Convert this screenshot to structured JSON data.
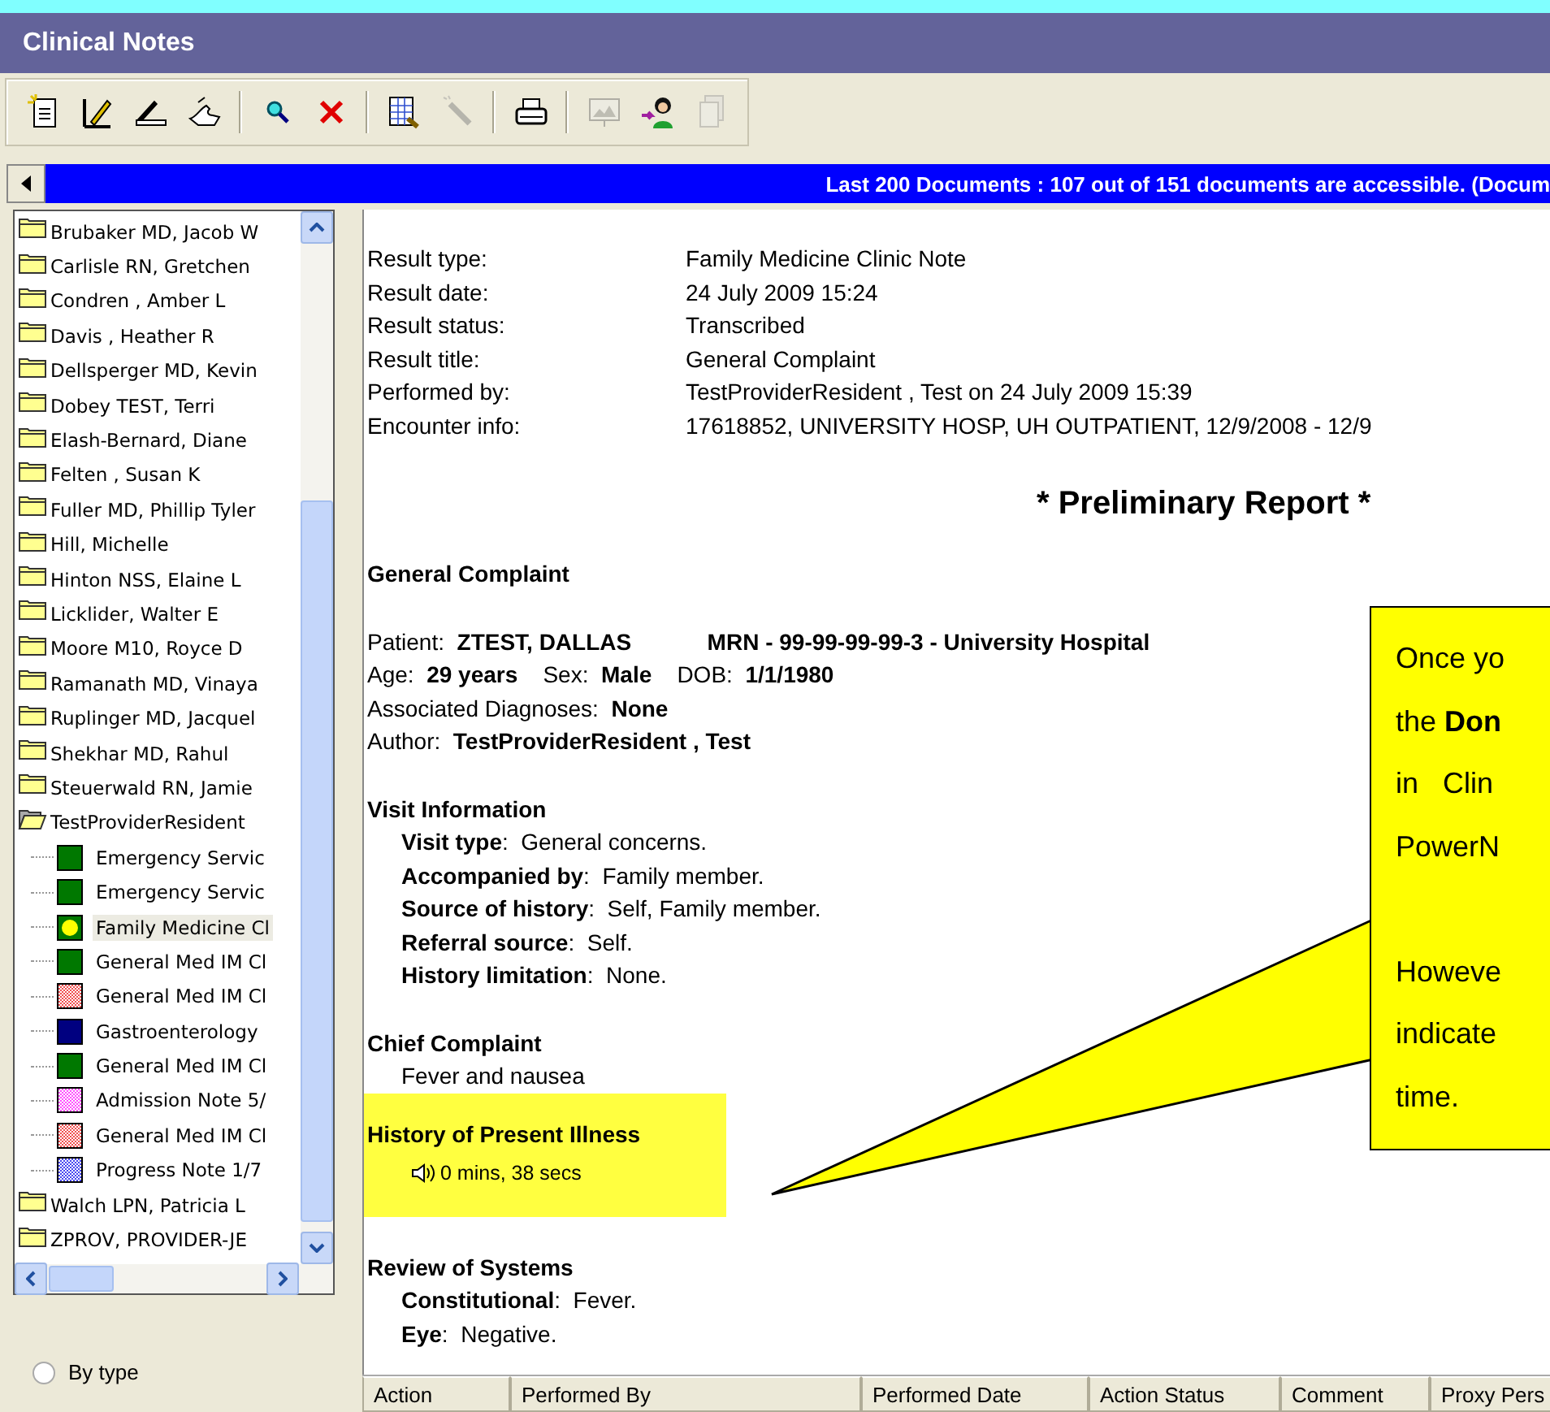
{
  "window": {
    "title": "Clinical Notes"
  },
  "toolbar": [
    [
      {
        "kind": "new-document",
        "disabled": false
      },
      {
        "kind": "sign",
        "disabled": false
      },
      {
        "kind": "tray",
        "disabled": false
      },
      {
        "kind": "hand",
        "disabled": false
      }
    ],
    [
      {
        "kind": "find",
        "disabled": false
      },
      {
        "kind": "delete",
        "disabled": false
      }
    ],
    [
      {
        "kind": "sheet",
        "disabled": false
      },
      {
        "kind": "wand",
        "disabled": true
      }
    ],
    [
      {
        "kind": "print",
        "disabled": false
      }
    ],
    [
      {
        "kind": "screen",
        "disabled": true
      },
      {
        "kind": "person",
        "disabled": false
      },
      {
        "kind": "pages",
        "disabled": true
      }
    ]
  ],
  "info_bar": {
    "text": "Last 200 Documents : 107 out of 151 documents are accessible. (Docum"
  },
  "tree": [
    {
      "label": "Brubaker MD, Jacob W",
      "expanded": false,
      "selected": false
    },
    {
      "label": "Carlisle RN, Gretchen",
      "expanded": false,
      "selected": false
    },
    {
      "label": "Condren , Amber L",
      "expanded": false,
      "selected": false
    },
    {
      "label": "Davis , Heather R",
      "expanded": false,
      "selected": false
    },
    {
      "label": "Dellsperger MD, Kevin",
      "expanded": false,
      "selected": false
    },
    {
      "label": "Dobey TEST, Terri",
      "expanded": false,
      "selected": false
    },
    {
      "label": "Elash-Bernard, Diane",
      "expanded": false,
      "selected": false
    },
    {
      "label": "Felten , Susan K",
      "expanded": false,
      "selected": false
    },
    {
      "label": "Fuller MD, Phillip Tyler",
      "expanded": false,
      "selected": false
    },
    {
      "label": "Hill, Michelle",
      "expanded": false,
      "selected": false
    },
    {
      "label": "Hinton NSS, Elaine L",
      "expanded": false,
      "selected": false
    },
    {
      "label": "Licklider, Walter E",
      "expanded": false,
      "selected": false
    },
    {
      "label": "Moore M10, Royce D",
      "expanded": false,
      "selected": false
    },
    {
      "label": "Ramanath MD, Vinaya",
      "expanded": false,
      "selected": false
    },
    {
      "label": "Ruplinger MD, Jacquel",
      "expanded": false,
      "selected": false
    },
    {
      "label": "Shekhar MD, Rahul",
      "expanded": false,
      "selected": false
    },
    {
      "label": "Steuerwald RN, Jamie",
      "expanded": false,
      "selected": false
    },
    {
      "label": "TestProviderResident",
      "expanded": true,
      "selected": false,
      "children": [
        {
          "label": "Emergency Servic",
          "kind": "solid",
          "color": "#007800",
          "selected": false
        },
        {
          "label": "Emergency Servic",
          "kind": "solid",
          "color": "#007800",
          "selected": false
        },
        {
          "label": "Family Medicine Cl",
          "kind": "circle",
          "color": "#007800",
          "selected": true
        },
        {
          "label": "General Med IM Cl",
          "kind": "solid",
          "color": "#007800",
          "selected": false
        },
        {
          "label": "General Med IM Cl",
          "kind": "dotted",
          "color": "#f05050",
          "selected": false
        },
        {
          "label": "Gastroenterology",
          "kind": "solid",
          "color": "#000080",
          "selected": false
        },
        {
          "label": "General Med IM Cl",
          "kind": "solid",
          "color": "#007800",
          "selected": false
        },
        {
          "label": "Admission Note 5/",
          "kind": "dotted",
          "color": "#ff50ff",
          "selected": false
        },
        {
          "label": "General Med IM Cl",
          "kind": "dotted",
          "color": "#f05050",
          "selected": false
        },
        {
          "label": "Progress Note 1/7",
          "kind": "dotted",
          "color": "#4848f0",
          "selected": false
        }
      ]
    },
    {
      "label": "Walch LPN, Patricia L",
      "expanded": false,
      "selected": false
    },
    {
      "label": "ZPROV, PROVIDER-JE",
      "expanded": false,
      "selected": false
    }
  ],
  "view_options": [
    {
      "label": "By type",
      "selected": false
    }
  ],
  "report": {
    "fields": [
      {
        "label": "Result type:",
        "value": "Family Medicine Clinic Note"
      },
      {
        "label": "Result date:",
        "value": "24 July 2009 15:24"
      },
      {
        "label": "Result status:",
        "value": "Transcribed"
      },
      {
        "label": "Result title:",
        "value": "General Complaint"
      },
      {
        "label": "Performed by:",
        "value": "TestProviderResident , Test on 24 July 2009 15:39"
      },
      {
        "label": "Encounter info:",
        "value": "17618852, UNIVERSITY HOSP, UH OUTPATIENT, 12/9/2008 - 12/9"
      }
    ],
    "banner": "* Preliminary Report *",
    "sections": [
      {
        "title": "General Complaint",
        "highlighted": false
      },
      {
        "highlighted": false,
        "kind": "plain",
        "lines": [
          "Patient:  **ZTEST, DALLAS**            **MRN - 99-99-99-99-3 - University Hospital**",
          "Age:  **29 years**    Sex:  **Male**    DOB:  **1/1/1980**",
          "Associated Diagnoses:  **None**",
          "Author:  **TestProviderResident , Test**"
        ]
      },
      {
        "title": "Visit Information",
        "highlighted": false,
        "kind": "indented",
        "lines": [
          "**Visit type**:  General concerns.",
          "**Accompanied by**:  Family member.",
          "**Source of history**:  Self, Family member.",
          "**Referral source**:  Self.",
          "**History limitation**:  None."
        ]
      },
      {
        "title": "Chief Complaint",
        "highlighted": false,
        "kind": "indented",
        "lines": [
          "Fever and nausea"
        ]
      },
      {
        "title": "History of Present Illness",
        "highlighted": true,
        "kind": "audio",
        "lines": [
          "0 mins, 38 secs"
        ]
      },
      {
        "title": "Review of Systems",
        "highlighted": false,
        "kind": "indented",
        "lines": [
          "**Constitutional**:  Fever.",
          "**Eye**:  Negative."
        ]
      }
    ]
  },
  "actions_table": {
    "columns": [
      "Action",
      "Performed By",
      "Performed Date",
      "Action Status",
      "Comment",
      "Proxy Pers"
    ]
  },
  "callout": {
    "paragraphs": [
      [
        "Once yo",
        "the **Don**",
        "in   Clin",
        "PowerN"
      ],
      [
        "Howeve",
        "indicate",
        "time."
      ]
    ]
  }
}
